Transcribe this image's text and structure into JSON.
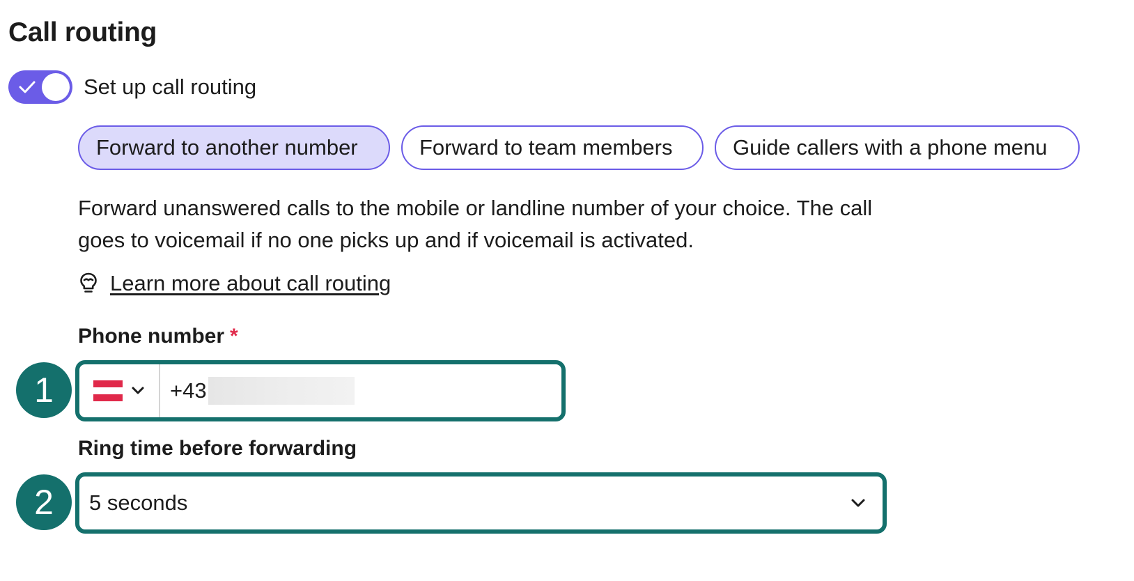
{
  "page": {
    "title": "Call routing"
  },
  "routing_toggle": {
    "label": "Set up call routing",
    "enabled": true,
    "color": "#6b5ce7"
  },
  "options": {
    "items": [
      {
        "label": "Forward to another number",
        "selected": true
      },
      {
        "label": "Forward to team members",
        "selected": false
      },
      {
        "label": "Guide callers with a phone menu",
        "selected": false
      }
    ]
  },
  "description": "Forward unanswered calls to the mobile or landline number of your choice. The call goes to voicemail if no one picks up and if voicemail is activated.",
  "learn_more": {
    "icon": "lightbulb-icon",
    "label": "Learn more about call routing"
  },
  "phone_field": {
    "label": "Phone number",
    "required_marker": "*",
    "country_flag": "austria-flag-icon",
    "prefix": "+43",
    "value": ""
  },
  "ring_field": {
    "label": "Ring time before forwarding",
    "value": "5 seconds"
  },
  "annotations": {
    "badge_1": "1",
    "badge_2": "2",
    "color": "#14706c"
  }
}
